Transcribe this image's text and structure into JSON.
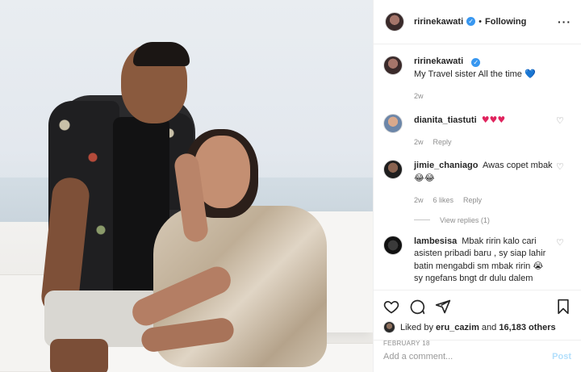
{
  "post": {
    "author": "ririnekawati",
    "follow_state": "Following",
    "more_icon": "more-horizontal-icon"
  },
  "caption": {
    "user": "ririnekawati",
    "text": "My Travel sister All the time",
    "emoji": "💙",
    "age": "2w"
  },
  "comments": [
    {
      "user": "dianita_tiastuti",
      "text": "",
      "emoji": "♥♥♥",
      "age": "2w",
      "reply_label": "Reply",
      "likes": ""
    },
    {
      "user": "jimie_chaniago",
      "text": "Awas copet mbak",
      "emoji": "😂😂",
      "age": "2w",
      "likes": "6 likes",
      "reply_label": "Reply"
    },
    {
      "user": "lambesisa",
      "text": "Mbak ririn kalo cari asisten pribadi baru , sy siap lahir batin mengabdi sm mbak ririn",
      "emoji": "😭",
      "overflow": "sy ngefans bngt dr dulu dalem"
    }
  ],
  "view_replies": "View replies (1)",
  "likes": {
    "prefix": "Liked by",
    "user": "eru_cazim",
    "and": "and",
    "count": "16,183 others"
  },
  "date": "FEBRUARY 18",
  "add_comment": {
    "placeholder": "Add a comment...",
    "post_label": "Post"
  },
  "colors": {
    "link_blue": "#3897f0",
    "post_disabled": "#b2dffc",
    "muted": "#8e8e8e"
  }
}
